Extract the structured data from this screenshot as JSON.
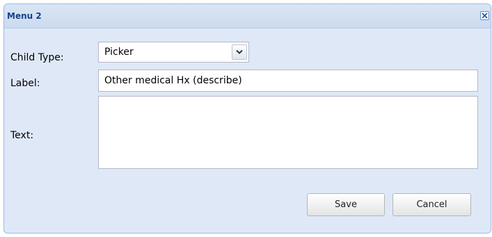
{
  "window": {
    "title": "Menu 2",
    "close_icon": "close-icon"
  },
  "form": {
    "child_type": {
      "label": "Child Type:",
      "value": "Picker",
      "trigger_icon": "chevron-down-icon"
    },
    "label_field": {
      "label": "Label:",
      "value": "Other medical Hx (describe)"
    },
    "text_field": {
      "label": "Text:",
      "value": ""
    }
  },
  "buttons": {
    "save_label": "Save",
    "cancel_label": "Cancel"
  },
  "colors": {
    "title_text": "#15428b",
    "panel_background": "#dfe8f6",
    "panel_border": "#99bbe8"
  }
}
